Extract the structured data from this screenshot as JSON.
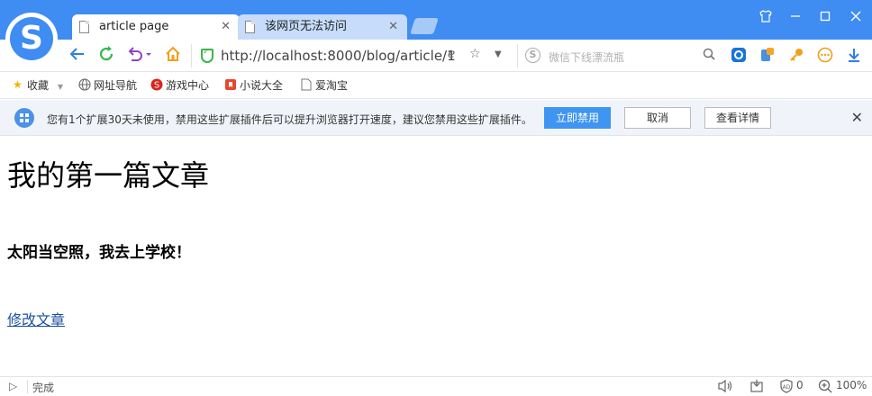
{
  "tabs": [
    {
      "title": "article page",
      "active": true
    },
    {
      "title": "该网页无法访问",
      "active": false
    }
  ],
  "window_controls": [
    "skin-icon",
    "minimize-icon",
    "maximize-icon",
    "close-icon"
  ],
  "address": {
    "url": "http://localhost:8000/blog/article/1"
  },
  "search": {
    "placeholder": "微信下线漂流瓶"
  },
  "bookmarks": [
    {
      "label": "收藏",
      "icon": "star-icon"
    },
    {
      "label": "网址导航",
      "icon": "globe-icon"
    },
    {
      "label": "游戏中心",
      "icon": "game-icon"
    },
    {
      "label": "小说大全",
      "icon": "book-icon"
    },
    {
      "label": "爱淘宝",
      "icon": "page-icon"
    }
  ],
  "notice": {
    "message": "您有1个扩展30天未使用，禁用这些扩展插件后可以提升浏览器打开速度，建议您禁用这些扩展插件。",
    "disable_label": "立即禁用",
    "cancel_label": "取消",
    "details_label": "查看详情"
  },
  "page": {
    "heading": "我的第一篇文章",
    "body": "太阳当空照，我去上学校！",
    "edit_link": "修改文章"
  },
  "status": {
    "text": "完成",
    "blocked_count": "0",
    "zoom": "100%"
  },
  "colors": {
    "title_bar": "#3f8cf2",
    "primary_button": "#3f95f2",
    "link": "#1a4f9c",
    "notice_bg": "#f0f4fa"
  }
}
